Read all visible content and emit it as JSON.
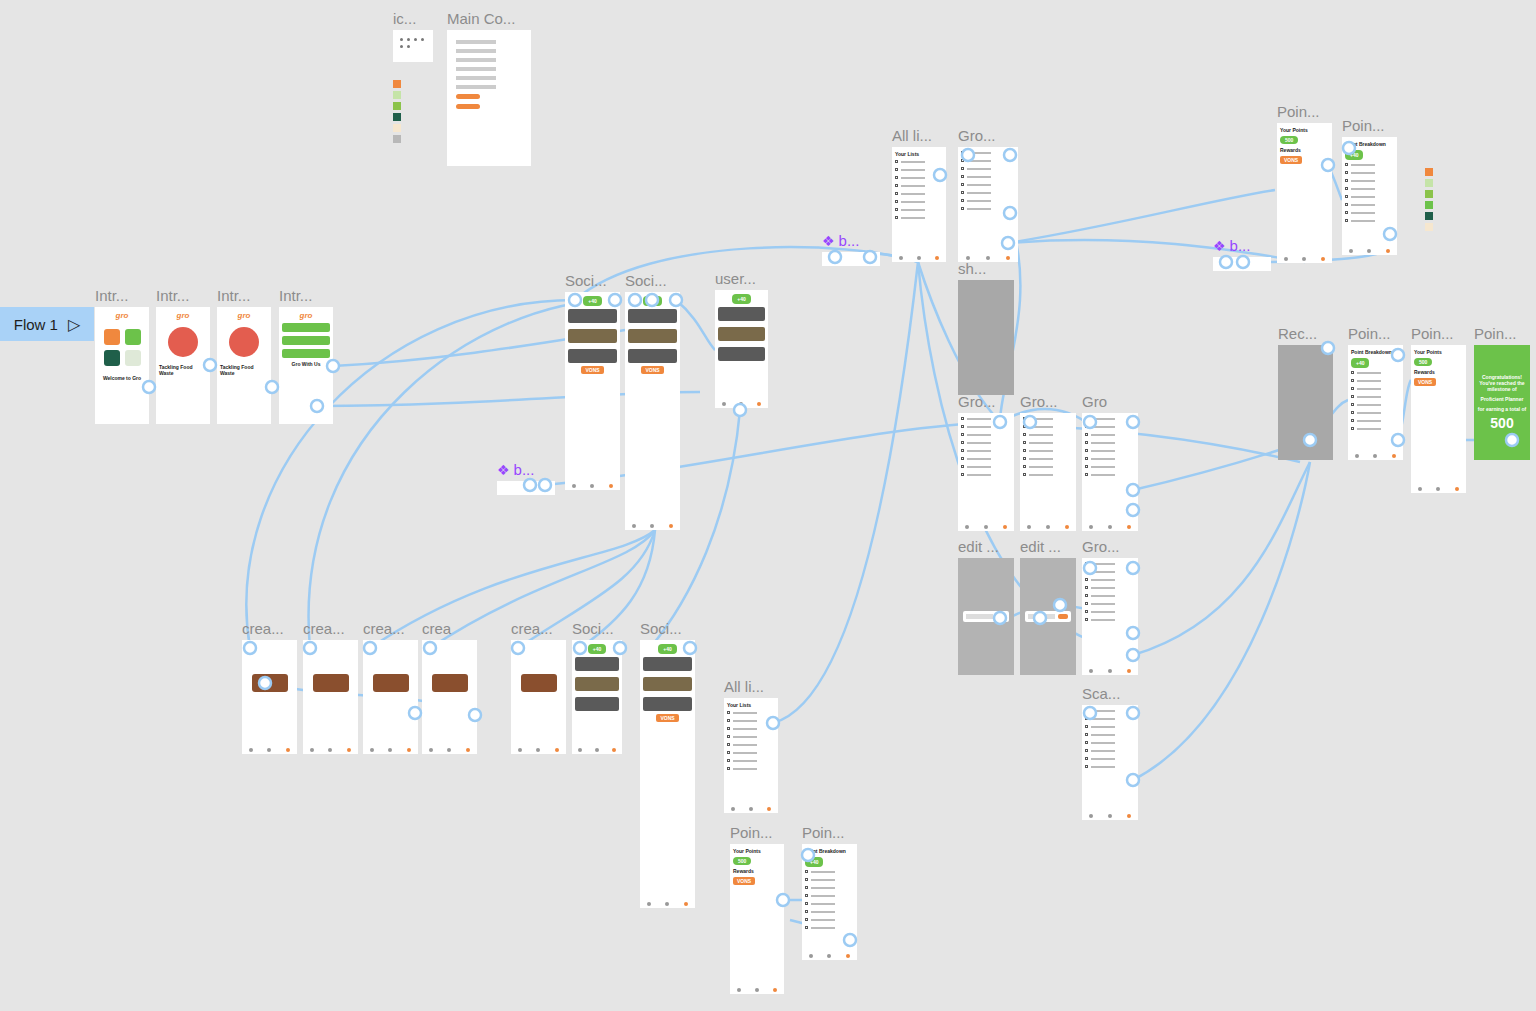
{
  "flow": {
    "label": "Flow 1",
    "icon": "▷"
  },
  "frames": [
    {
      "label": "ic...",
      "kind": "icons"
    },
    {
      "label": "Main Co...",
      "kind": "library"
    },
    {
      "label": "Intr...",
      "kind": "welcome",
      "logo": "gro",
      "title": "Welcome to Gro"
    },
    {
      "label": "Intr...",
      "kind": "waste",
      "logo": "gro",
      "title": "Tackling Food Waste"
    },
    {
      "label": "Intr...",
      "kind": "waste",
      "logo": "gro",
      "title": "Tackling Food Waste"
    },
    {
      "label": "Intr...",
      "kind": "join",
      "logo": "gro",
      "title": "Gro With Us"
    },
    {
      "label": "Soci...",
      "kind": "social",
      "badge": "+40",
      "store": "VONS"
    },
    {
      "label": "Soci...",
      "kind": "social",
      "badge": "+40",
      "store": "VONS"
    },
    {
      "label": "user...",
      "kind": "social",
      "badge": "+40"
    },
    {
      "label": "All li...",
      "kind": "lists",
      "title": "Your Lists"
    },
    {
      "label": "Gro...",
      "kind": "grocery"
    },
    {
      "label": "Poin...",
      "kind": "points",
      "title": "Your Points",
      "points": "500",
      "section": "Rewards",
      "store": "VONS"
    },
    {
      "label": "Poin...",
      "kind": "breakdown",
      "title": "Point Breakdown",
      "badge": "+40"
    },
    {
      "label": "sh...",
      "kind": "photo"
    },
    {
      "label": "Gro...",
      "kind": "grocery"
    },
    {
      "label": "Gro...",
      "kind": "grocery"
    },
    {
      "label": "Gro",
      "kind": "grocery"
    },
    {
      "label": "Rec...",
      "kind": "photo"
    },
    {
      "label": "Poin...",
      "kind": "breakdown",
      "title": "Point Breakdown",
      "badge": "+40"
    },
    {
      "label": "Poin...",
      "kind": "points",
      "title": "Your Points",
      "points": "500",
      "section": "Rewards",
      "store": "VONS"
    },
    {
      "label": "Poin...",
      "kind": "milestone",
      "lines": [
        "Congratulations! You've reached the milestone of",
        "Proficient Planner",
        "for earning a total of"
      ],
      "points": "500"
    },
    {
      "label": "edit ...",
      "kind": "edit"
    },
    {
      "label": "edit ...",
      "kind": "edit"
    },
    {
      "label": "Gro...",
      "kind": "grocery"
    },
    {
      "label": "Sca...",
      "kind": "grocery"
    },
    {
      "label": "crea...",
      "kind": "create"
    },
    {
      "label": "crea...",
      "kind": "create"
    },
    {
      "label": "crea...",
      "kind": "create"
    },
    {
      "label": "crea",
      "kind": "create"
    },
    {
      "label": "crea...",
      "kind": "create"
    },
    {
      "label": "Soci...",
      "kind": "social",
      "badge": "+40"
    },
    {
      "label": "Soci...",
      "kind": "social",
      "badge": "+40",
      "store": "VONS"
    },
    {
      "label": "All li...",
      "kind": "lists",
      "title": "Your Lists"
    },
    {
      "label": "Poin...",
      "kind": "points",
      "title": "Your Points",
      "points": "500",
      "section": "Rewards",
      "store": "VONS"
    },
    {
      "label": "Poin...",
      "kind": "breakdown",
      "title": "Point Breakdown",
      "badge": "+40"
    }
  ],
  "components": [
    {
      "icon": "❖",
      "label": "b..."
    },
    {
      "icon": "❖",
      "label": "b..."
    },
    {
      "icon": "❖",
      "label": "b..."
    }
  ]
}
